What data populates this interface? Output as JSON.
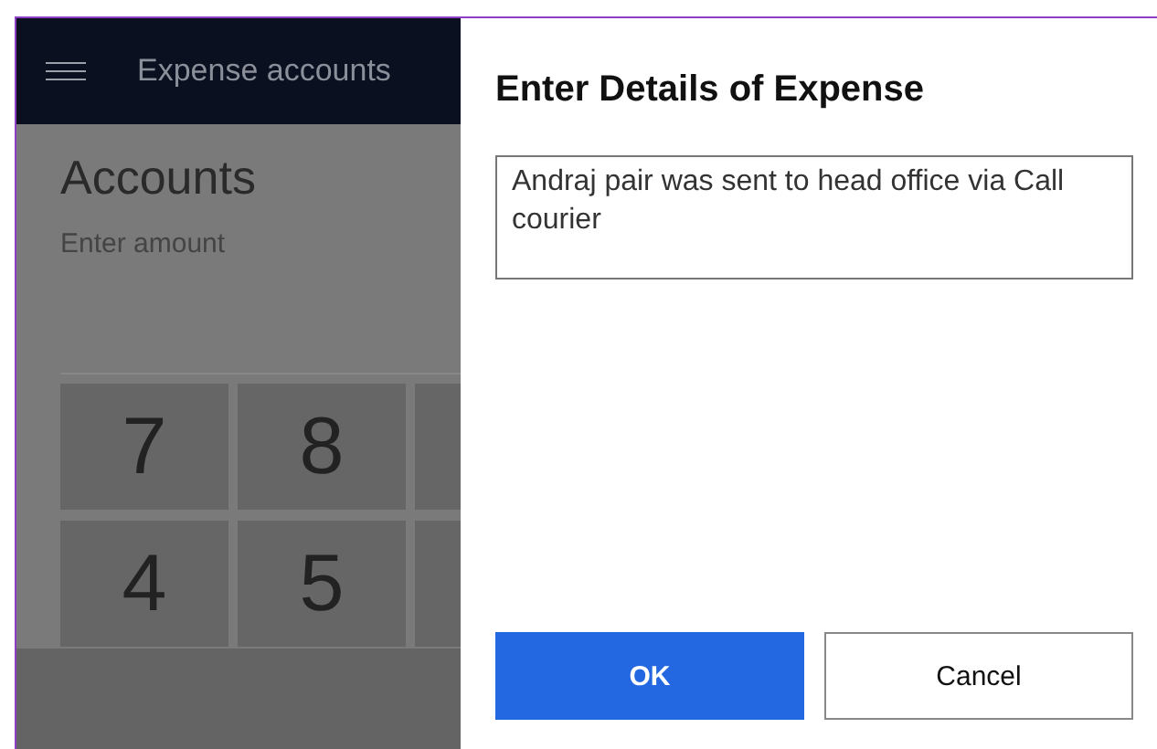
{
  "app": {
    "header_title": "Expense accounts",
    "page_title": "Accounts",
    "amount_label": "Enter amount",
    "keypad_rows": [
      [
        "7",
        "8"
      ],
      [
        "4",
        "5"
      ]
    ]
  },
  "dialog": {
    "title": "Enter Details of Expense",
    "details_value": "Andraj pair was sent to head office via Call courier",
    "buttons": [
      {
        "label": "OK",
        "kind": "primary"
      },
      {
        "label": "Cancel",
        "kind": "secondary"
      }
    ]
  }
}
